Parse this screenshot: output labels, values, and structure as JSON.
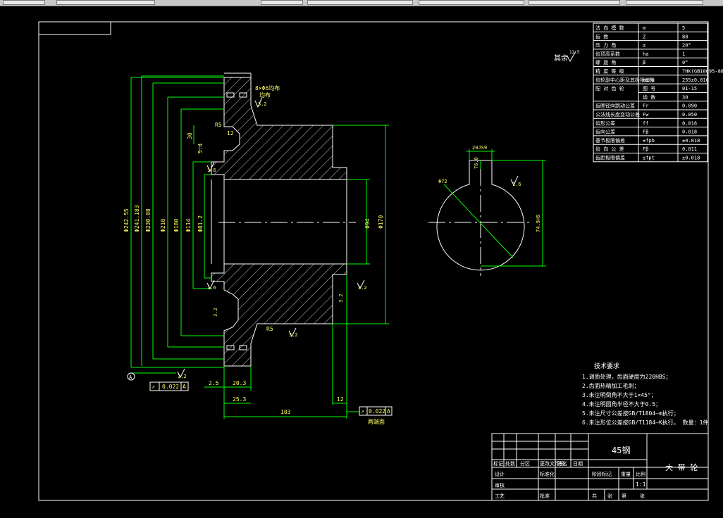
{
  "colors": {
    "paper": "#000000",
    "outline": "#ffffff",
    "dimension": "#00ff00",
    "label": "#ffff66"
  },
  "roughness_label": "其余",
  "roughness_symbol_value": "12.5",
  "param_table": [
    {
      "name": "法 向 模 数",
      "sym": "m",
      "val": "5"
    },
    {
      "name": "齿 数",
      "sym": "Z",
      "val": "80"
    },
    {
      "name": "压 力 角",
      "sym": "α",
      "val": "20°"
    },
    {
      "name": "齿顶高系数",
      "sym": "ha",
      "val": "1"
    },
    {
      "name": "螺 旋 角",
      "sym": "β",
      "val": "0°"
    },
    {
      "name": "精 度 等 级",
      "sym": "",
      "val": "7HK(GB10095-88)"
    },
    {
      "name": "齿轮副中心距及其极限偏差",
      "sym": "a±fa",
      "val": "255±0.016"
    },
    {
      "name": "配 对 齿 轮",
      "sym": "图 号",
      "val": "01-15"
    },
    {
      "name": "",
      "sym": "齿 数",
      "val": "30"
    },
    {
      "name": "齿圈径向跳动公差",
      "sym": "Fr",
      "val": "0.090"
    },
    {
      "name": "公法线长度变动公差",
      "sym": "Fw",
      "val": "0.050"
    },
    {
      "name": "齿形公差",
      "sym": "ff",
      "val": "0.016"
    },
    {
      "name": "齿向公差",
      "sym": "Fβ",
      "val": "0.018"
    },
    {
      "name": "基节极限偏差",
      "sym": "±fpb",
      "val": "±0.018"
    },
    {
      "name": "齿 向 公 差",
      "sym": "Fβ",
      "val": "0.011"
    },
    {
      "name": "齿距极限偏差",
      "sym": "±fpt",
      "val": "±0.018"
    }
  ],
  "dims": {
    "d_242_55": "Φ242.55",
    "d_241_183": "Φ241.183",
    "d_230_08": "Φ230.08",
    "d_210": "Φ210",
    "d_180": "Φ180",
    "d_114": "Φ114",
    "d_81_2": "Φ81.2",
    "d_94": "Φ94",
    "d_170": "Φ170",
    "dim_30": "30",
    "dim_5_4": "5.4",
    "r5_top": "R5",
    "r5_bot": "R5",
    "dim_12": "12",
    "dim_2_5": "2.5",
    "dim_20_3": "20.3",
    "dim_25_3": "25.3",
    "dim_103": "103",
    "dim_12b": "12",
    "hole_note": "8×Φ6均布",
    "hole_note2": "均布",
    "key_width": "20JS9",
    "key_depth": "76.8",
    "key_dia": "Φ72",
    "key_dim2": "74.9H9"
  },
  "roughness_vals": [
    "3.2",
    "1.6",
    "1.6",
    "3.2",
    "3.2",
    "3.2",
    "1.6",
    "3.2",
    "3.2"
  ],
  "tol_frame_left": {
    "sym": "↗",
    "val": "0.022",
    "ref": "A"
  },
  "tol_frame_bottom": {
    "sym": "↗",
    "val": "0.022",
    "ref": "A"
  },
  "datum_label": "A",
  "bottom_note": "两端面",
  "tech_req": {
    "title": "技术要求",
    "lines": [
      "1.调质处理，齿面硬度为220HBS；",
      "2.齿面热精加工毛刺；",
      "3.未注明倒角不大于1×45°；",
      "4.未注明圆角半径不大于0.5；",
      "5.未注尺寸公差按GB/T1804—m执行；",
      "6.未注形位公差按GB/T1184—K执行。    数量：1件"
    ]
  },
  "title_block": {
    "material": "45钢",
    "part_name": "大 带 轮",
    "scale": "1:1",
    "labels": {
      "mark": "标记",
      "count": "处数",
      "zone": "分区",
      "change_doc": "更改文件号",
      "sign": "签名",
      "date": "日期",
      "design": "设计",
      "standard": "标准化",
      "stage_mark": "阶段标记",
      "weight": "重量",
      "ratio": "比例",
      "check": "审核",
      "process": "工艺",
      "approve": "批准",
      "total": "共",
      "sheets": "张",
      "sheet": "第",
      "sheet2": "张"
    }
  }
}
